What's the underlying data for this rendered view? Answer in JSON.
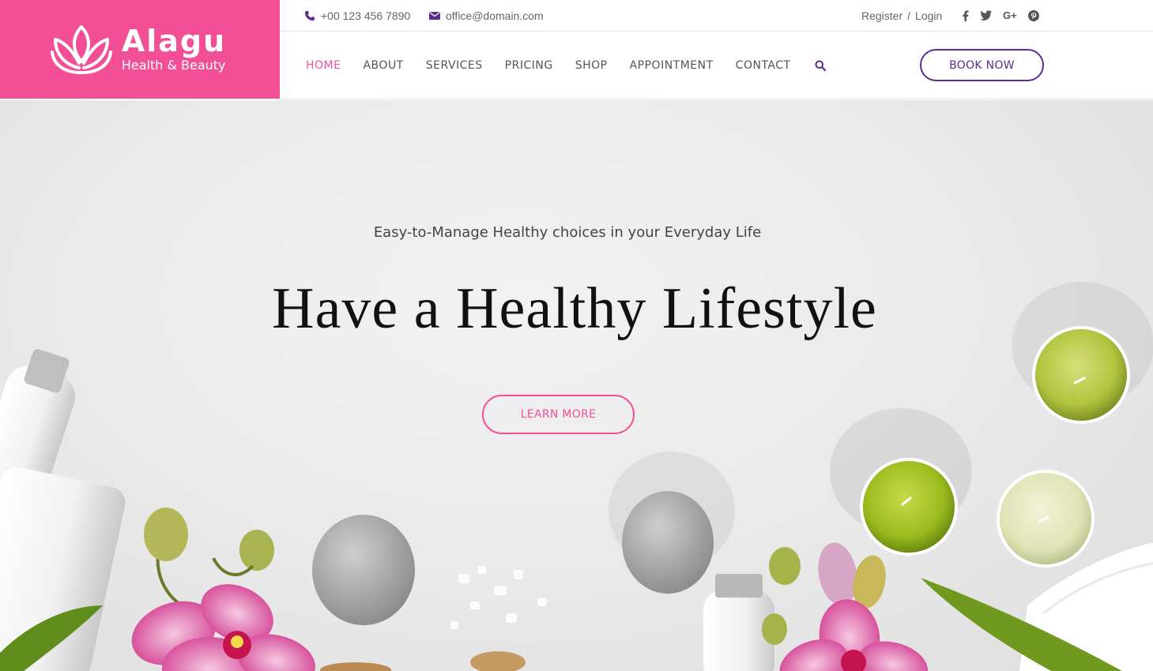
{
  "brand": {
    "name": "Alagu",
    "tagline": "Health & Beauty",
    "color": "#f24f97"
  },
  "topbar": {
    "phone": "+00 123 456 7890",
    "email": "office@domain.com",
    "register": "Register",
    "separator": "/",
    "login": "Login",
    "social": [
      "facebook-icon",
      "twitter-icon",
      "google-plus-icon",
      "pinterest-icon"
    ],
    "gplus_glyph": "G+"
  },
  "nav": {
    "items": [
      {
        "label": "HOME",
        "active": true
      },
      {
        "label": "ABOUT",
        "active": false
      },
      {
        "label": "SERVICES",
        "active": false
      },
      {
        "label": "PRICING",
        "active": false
      },
      {
        "label": "SHOP",
        "active": false
      },
      {
        "label": "APPOINTMENT",
        "active": false
      },
      {
        "label": "CONTACT",
        "active": false
      }
    ],
    "book_label": "BOOK NOW",
    "accent": "#5c2d91"
  },
  "hero": {
    "subtitle": "Easy-to-Manage Healthy choices in your Everyday Life",
    "title": "Have a Healthy Lifestyle",
    "cta": "LEARN MORE"
  }
}
